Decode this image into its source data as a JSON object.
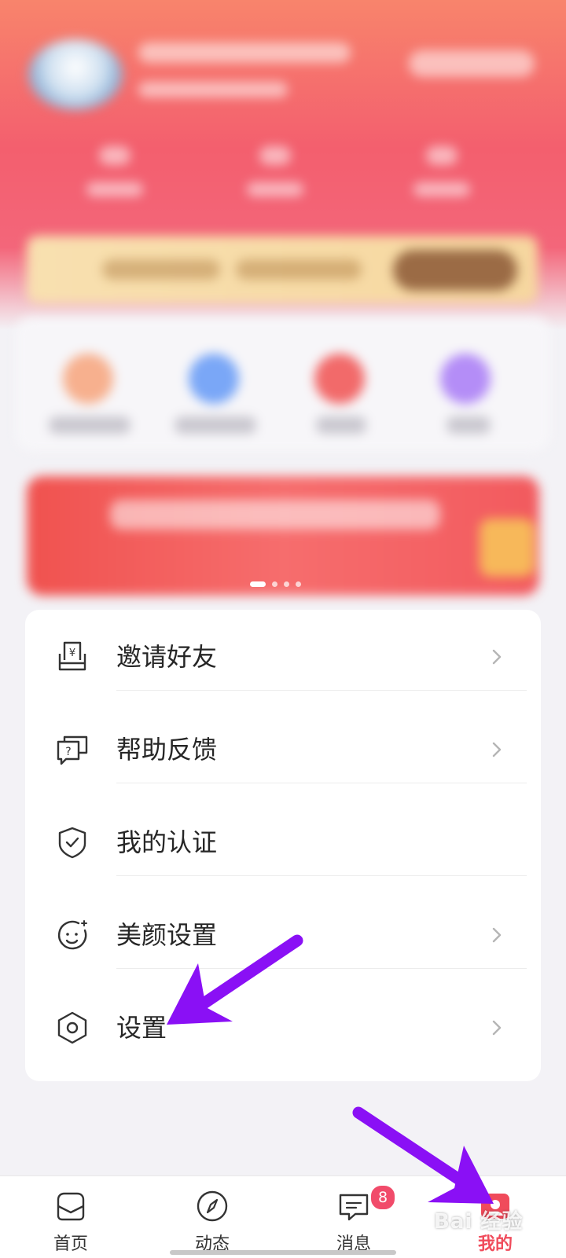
{
  "theme": {
    "accent": "#f04b5b",
    "arrow": "#8a10f5"
  },
  "menu": {
    "items": [
      {
        "label": "邀请好友",
        "icon": "invite-money-icon"
      },
      {
        "label": "帮助反馈",
        "icon": "help-feedback-icon"
      },
      {
        "label": "我的认证",
        "icon": "shield-check-icon"
      },
      {
        "label": "美颜设置",
        "icon": "beauty-face-icon"
      },
      {
        "label": "设置",
        "icon": "hexagon-gear-icon"
      }
    ]
  },
  "bottom_nav": {
    "tabs": [
      {
        "label": "首页",
        "icon": "home-icon"
      },
      {
        "label": "动态",
        "icon": "compass-icon"
      },
      {
        "label": "消息",
        "icon": "message-icon",
        "badge": "8"
      },
      {
        "label": "我的",
        "icon": "profile-icon",
        "active": true
      }
    ]
  },
  "watermark": "Bai 经验"
}
